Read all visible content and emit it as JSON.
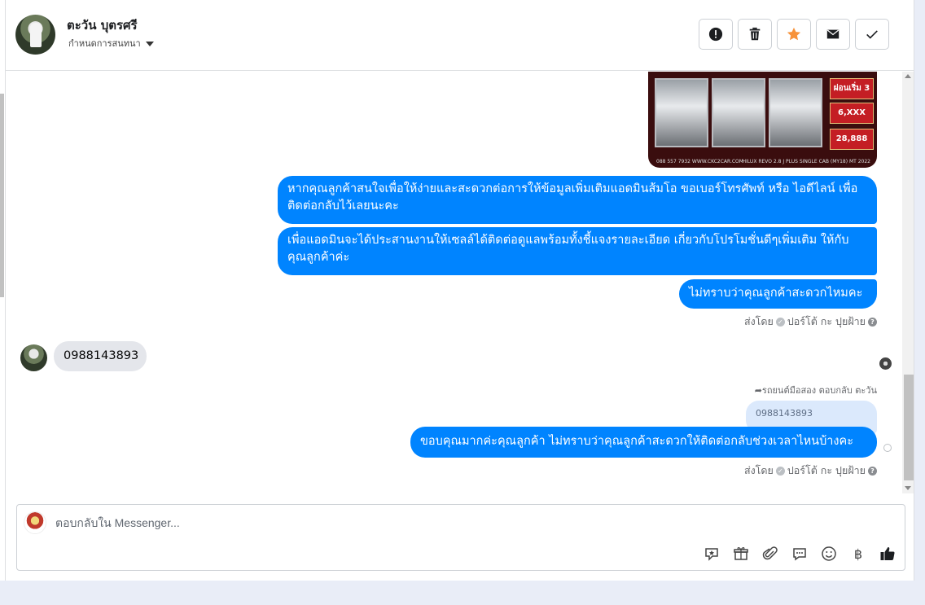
{
  "header": {
    "contact_name": "ตะวัน บุตรศรี",
    "subtitle": "กำหนดการสนทนา",
    "actions": [
      {
        "name": "spam-button",
        "icon": "exclamation-icon"
      },
      {
        "name": "delete-button",
        "icon": "trash-icon"
      },
      {
        "name": "star-button",
        "icon": "star-icon",
        "color": "#f7923a"
      },
      {
        "name": "mark-unread-button",
        "icon": "envelope-icon"
      },
      {
        "name": "mark-done-button",
        "icon": "check-icon"
      }
    ]
  },
  "promo_image": {
    "tags": [
      "ผ่อนเริ่ม 3 เดือน",
      "6,XXX",
      "28,888"
    ],
    "site": "088 557 7932 WWW.CKC2CAR.COM",
    "model": "HILUX REVO 2.8 J PLUS SINGLE CAB (MY18) MT 2022"
  },
  "messages": [
    {
      "direction": "out",
      "text": "หากคุณลูกค้าสนใจเพื่อให้ง่ายและสะดวกต่อการให้ข้อมูลเพิ่มเติมแอดมินส้มโอ ขอเบอร์โทรศัพท์ หรือ ไอดีไลน์ เพื่อติดต่อกลับไว้เลยนะคะ"
    },
    {
      "direction": "out",
      "text": "เพื่อแอดมินจะได้ประสานงานให้เซลล์ได้ติดต่อดูแลพร้อมทั้งชี้แจงรายละเอียด เกี่ยวกับโปรโมชั่นดีๆเพิ่มเติม ให้กับคุณลูกค้าค่ะ"
    },
    {
      "direction": "out",
      "text": "ไม่ทราบว่าคุณลูกค้าสะดวกไหมคะ"
    },
    {
      "direction": "in",
      "text": "0988143893"
    },
    {
      "direction": "out",
      "text": "ขอบคุณมากค่ะคุณลูกค้า ไม่ทราบว่าคุณลูกค้าสะดวกให้ติดต่อกลับช่วงเวลาไหนบ้างคะ"
    }
  ],
  "sent_by": "ส่งโดย",
  "sender_name": "ปอร์โต้ กะ ปุยฝ้าย",
  "reply_note": "รถยนต์มือสอง ตอบกลับ ตะวัน",
  "quoted_text": "0988143893",
  "composer": {
    "placeholder": "ตอบกลับใน Messenger...",
    "tools": [
      "sticker-icon",
      "gift-icon",
      "paperclip-icon",
      "chat-bubble-icon",
      "emoji-icon",
      "baht-icon",
      "thumbs-up-icon"
    ]
  },
  "colors": {
    "outgoing_bubble": "#0084ff",
    "incoming_bubble": "#e4e6eb",
    "star": "#f7923a"
  }
}
